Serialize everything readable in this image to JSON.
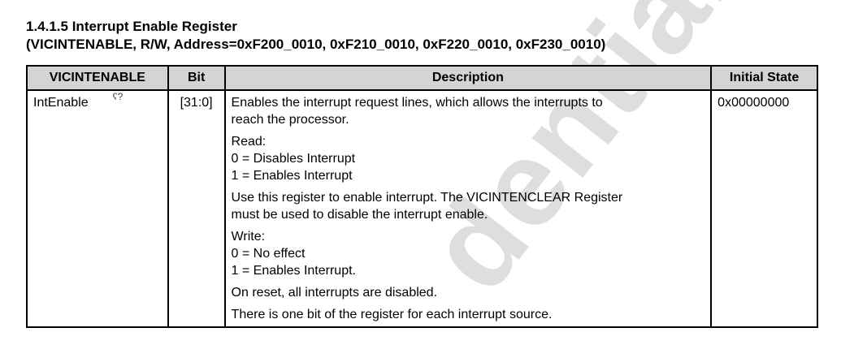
{
  "heading": {
    "section_title": "1.4.1.5 Interrupt Enable Register",
    "register_info": "(VICINTENABLE, R/W, Address=0xF200_0010, 0xF210_0010, 0xF220_0010, 0xF230_0010)"
  },
  "table": {
    "headers": {
      "name": "VICINTENABLE",
      "bit": "Bit",
      "description": "Description",
      "initial_state": "Initial State"
    },
    "rows": [
      {
        "name": "IntEnable",
        "mark": "ʕ?",
        "bit": "[31:0]",
        "initial_state": "0x00000000",
        "description": {
          "p1_line1": "Enables the interrupt request lines, which allows the interrupts to",
          "p1_line2": "reach the processor.",
          "p2_line1": "Read:",
          "p2_line2": "0 = Disables Interrupt",
          "p2_line3": "1 = Enables Interrupt",
          "p3_line1": "Use this register to enable interrupt. The VICINTENCLEAR Register",
          "p3_line2": "must be used to disable the interrupt enable.",
          "p4_line1": "Write:",
          "p4_line2": "0 = No effect",
          "p4_line3": "1 = Enables Interrupt.",
          "p5_line1": "On reset, all interrupts are disabled.",
          "p6_line1": "There is one bit of the register for each interrupt source."
        }
      }
    ]
  },
  "watermark": {
    "text": "dential",
    "color": "#d9d9d9"
  }
}
